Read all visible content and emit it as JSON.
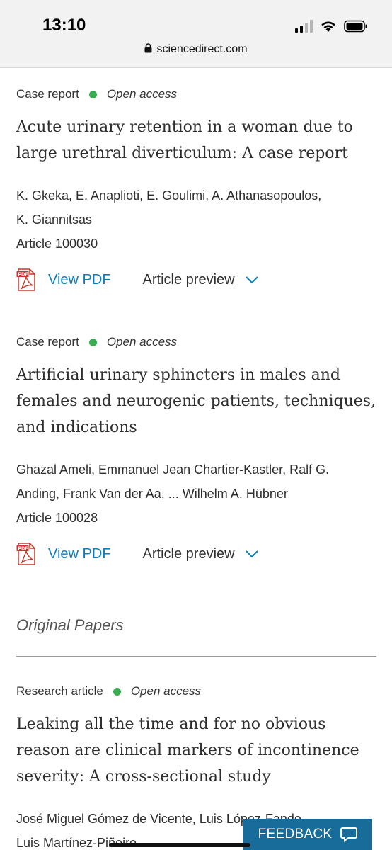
{
  "status_bar": {
    "time": "13:10"
  },
  "browser": {
    "url": "sciencedirect.com"
  },
  "articles": [
    {
      "type": "Case report",
      "access": "Open access",
      "title_lines": [
        "Acute urinary retention in a woman due to",
        "large urethral diverticulum: A case report"
      ],
      "author_lines": [
        "K. Gkeka, E. Anaplioti, E. Goulimi, A. Athanasopoulos,",
        "K. Giannitsas"
      ],
      "article_number": "Article 100030",
      "pdf_label": "View PDF",
      "preview_label": "Article preview"
    },
    {
      "type": "Case report",
      "access": "Open access",
      "title_lines": [
        "Artificial urinary sphincters in males and",
        "females and neurogenic patients, techniques,",
        "and indications"
      ],
      "author_lines": [
        "Ghazal Ameli, Emmanuel Jean Chartier-Kastler, Ralf G.",
        "Anding, Frank Van der Aa, ... Wilhelm A. Hübner"
      ],
      "article_number": "Article 100028",
      "pdf_label": "View PDF",
      "preview_label": "Article preview"
    },
    {
      "type": "Research article",
      "access": "Open access",
      "title_lines": [
        "Leaking all the time and for no obvious",
        "reason are clinical markers of incontinence",
        "severity: A cross-sectional study"
      ],
      "author_lines": [
        "José Miguel Gómez de Vicente, Luis López-Fando,",
        "Luis Martínez-Piñeiro"
      ]
    }
  ],
  "section_heading": "Original Papers",
  "feedback_label": "FEEDBACK",
  "icons": {
    "pdf": "pdf-file-icon",
    "chevron": "chevron-down-icon",
    "feedback": "chat-bubble-icon",
    "lock": "lock-icon"
  },
  "colors": {
    "link": "#0c7dbb",
    "open_access_dot": "#3bab54",
    "feedback_bg": "#186c9a"
  }
}
